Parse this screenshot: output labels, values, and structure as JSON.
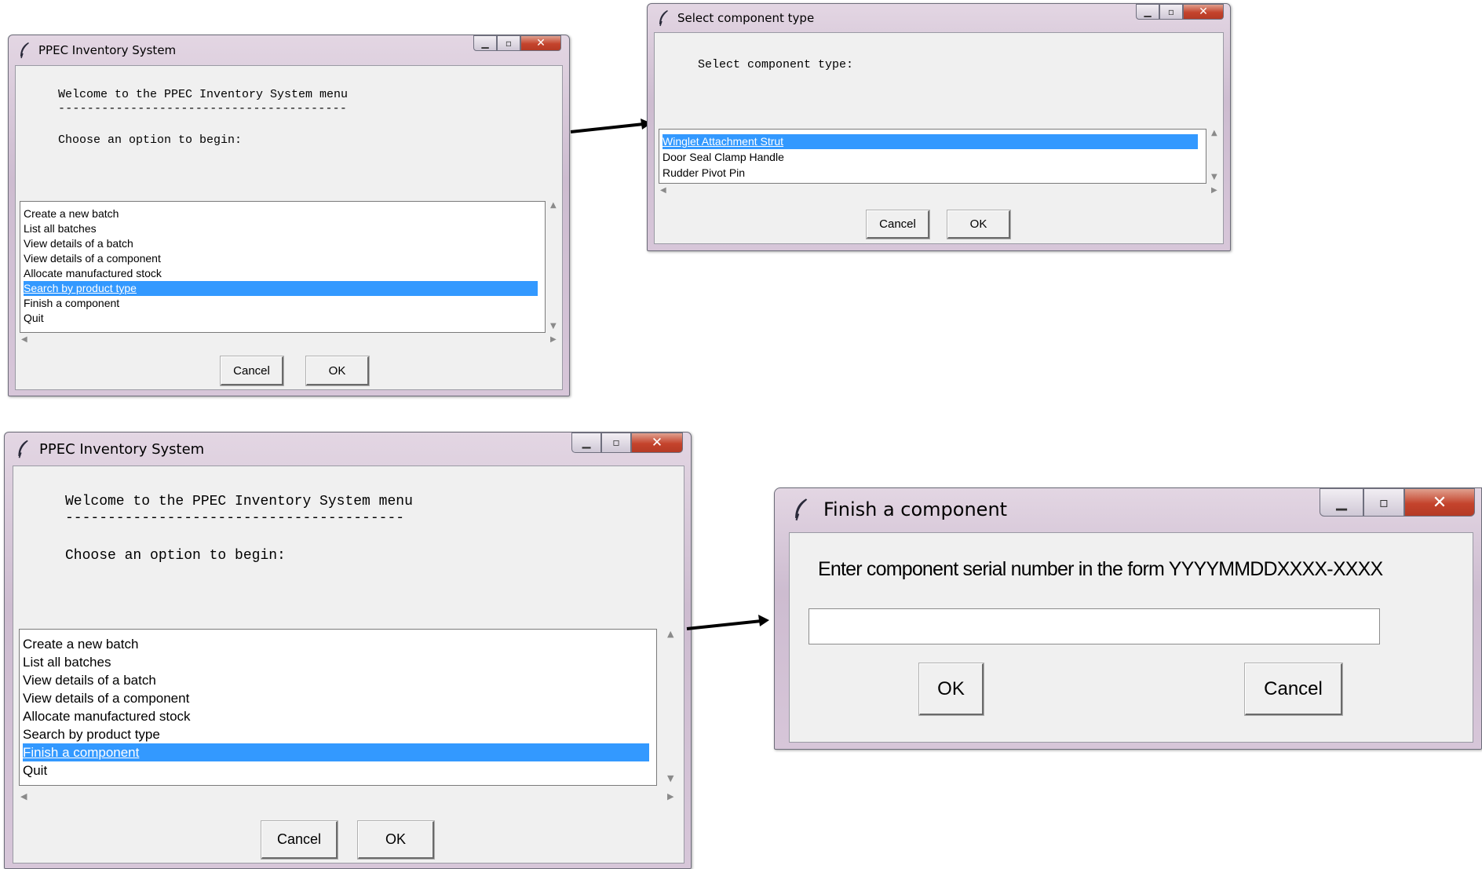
{
  "menu_small": {
    "title": "PPEC Inventory System",
    "welcome": "Welcome to the PPEC Inventory System menu",
    "rule": "----------------------------------------",
    "choose": "Choose an option to begin:",
    "items": [
      "Create a new batch",
      "List all batches",
      "View details of a batch",
      "View details of a component",
      "Allocate manufactured stock",
      "Search by product type",
      "Finish a component",
      "Quit"
    ],
    "selected": "Search by product type",
    "cancel_label": "Cancel",
    "ok_label": "OK"
  },
  "component_type": {
    "title": "Select component type",
    "prompt": "Select component type:",
    "items": [
      "Winglet Attachment Strut",
      "Door Seal Clamp Handle",
      "Rudder Pivot Pin"
    ],
    "selected": "Winglet Attachment Strut",
    "cancel_label": "Cancel",
    "ok_label": "OK"
  },
  "menu_large": {
    "title": "PPEC Inventory System",
    "welcome": "Welcome to the PPEC Inventory System menu",
    "rule": "----------------------------------------",
    "choose": "Choose an option to begin:",
    "items": [
      "Create a new batch",
      "List all batches",
      "View details of a batch",
      "View details of a component",
      "Allocate manufactured stock",
      "Search by product type",
      "Finish a component",
      "Quit"
    ],
    "selected": "Finish a component",
    "cancel_label": "Cancel",
    "ok_label": "OK"
  },
  "finish_component": {
    "title": "Finish a component",
    "prompt": "Enter component serial number in the form YYYYMMDDXXXX-XXXX",
    "input_value": "",
    "ok_label": "OK",
    "cancel_label": "Cancel"
  },
  "icons": [
    "feather-icon",
    "minimize-icon",
    "maximize-icon",
    "close-icon",
    "scroll-up-icon",
    "scroll-down-icon",
    "scroll-left-icon",
    "scroll-right-icon"
  ],
  "colors": {
    "selection": "#3399ff",
    "client_bg": "#f0f0f0",
    "close_button": "#c4432c"
  }
}
